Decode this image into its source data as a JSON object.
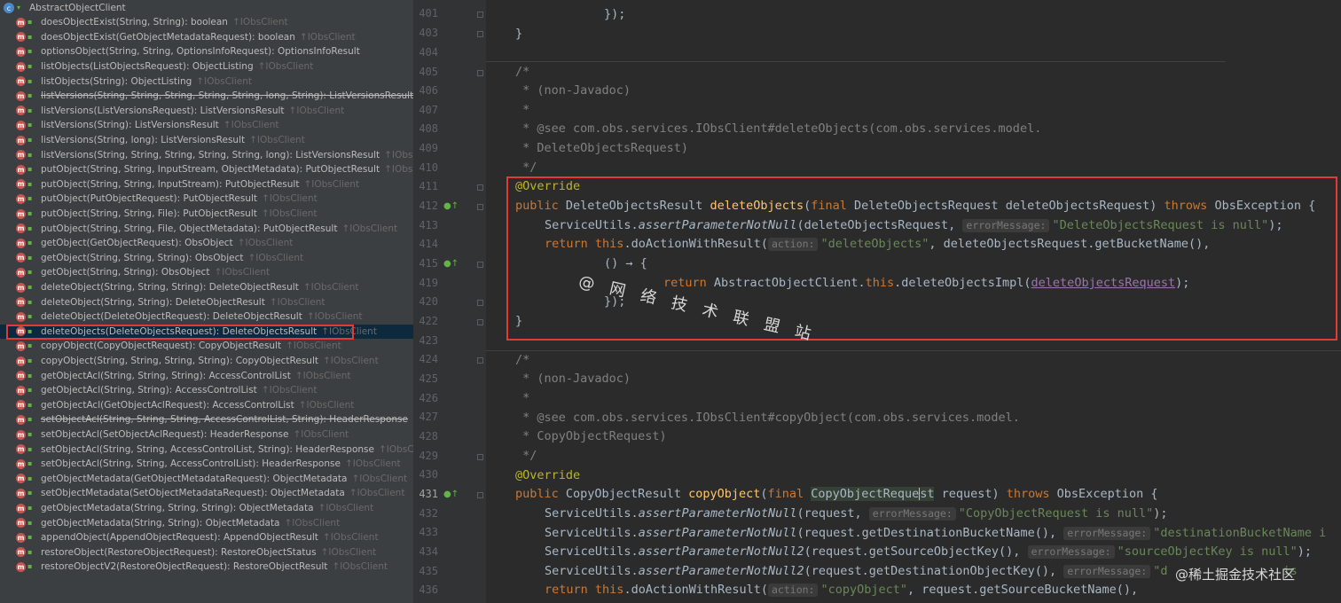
{
  "structure": {
    "root_label": "AbstractObjectClient",
    "methods": [
      {
        "sig": "doesObjectExist(String, String): boolean",
        "iface": "↑IObsClient",
        "deprecated": false
      },
      {
        "sig": "doesObjectExist(GetObjectMetadataRequest): boolean",
        "iface": "↑IObsClient",
        "deprecated": false
      },
      {
        "sig": "optionsObject(String, String, OptionsInfoRequest): OptionsInfoResult",
        "iface": "",
        "deprecated": false
      },
      {
        "sig": "listObjects(ListObjectsRequest): ObjectListing",
        "iface": "↑IObsClient",
        "deprecated": false
      },
      {
        "sig": "listObjects(String): ObjectListing",
        "iface": "↑IObsClient",
        "deprecated": false
      },
      {
        "sig": "listVersions(String, String, String, String, String, long, String): ListVersionsResult",
        "iface": "",
        "deprecated": true
      },
      {
        "sig": "listVersions(ListVersionsRequest): ListVersionsResult",
        "iface": "↑IObsClient",
        "deprecated": false
      },
      {
        "sig": "listVersions(String): ListVersionsResult",
        "iface": "↑IObsClient",
        "deprecated": false
      },
      {
        "sig": "listVersions(String, long): ListVersionsResult",
        "iface": "↑IObsClient",
        "deprecated": false
      },
      {
        "sig": "listVersions(String, String, String, String, String, long): ListVersionsResult",
        "iface": "↑IObsClient",
        "deprecated": false
      },
      {
        "sig": "putObject(String, String, InputStream, ObjectMetadata): PutObjectResult",
        "iface": "↑IObsClient",
        "deprecated": false
      },
      {
        "sig": "putObject(String, String, InputStream): PutObjectResult",
        "iface": "↑IObsClient",
        "deprecated": false
      },
      {
        "sig": "putObject(PutObjectRequest): PutObjectResult",
        "iface": "↑IObsClient",
        "deprecated": false
      },
      {
        "sig": "putObject(String, String, File): PutObjectResult",
        "iface": "↑IObsClient",
        "deprecated": false
      },
      {
        "sig": "putObject(String, String, File, ObjectMetadata): PutObjectResult",
        "iface": "↑IObsClient",
        "deprecated": false
      },
      {
        "sig": "getObject(GetObjectRequest): ObsObject",
        "iface": "↑IObsClient",
        "deprecated": false
      },
      {
        "sig": "getObject(String, String, String): ObsObject",
        "iface": "↑IObsClient",
        "deprecated": false
      },
      {
        "sig": "getObject(String, String): ObsObject",
        "iface": "↑IObsClient",
        "deprecated": false
      },
      {
        "sig": "deleteObject(String, String, String): DeleteObjectResult",
        "iface": "↑IObsClient",
        "deprecated": false
      },
      {
        "sig": "deleteObject(String, String): DeleteObjectResult",
        "iface": "↑IObsClient",
        "deprecated": false
      },
      {
        "sig": "deleteObject(DeleteObjectRequest): DeleteObjectResult",
        "iface": "↑IObsClient",
        "deprecated": false
      },
      {
        "sig": "deleteObjects(DeleteObjectsRequest): DeleteObjectsResult",
        "iface": "↑IObsClient",
        "deprecated": false
      },
      {
        "sig": "copyObject(CopyObjectRequest): CopyObjectResult",
        "iface": "↑IObsClient",
        "deprecated": false
      },
      {
        "sig": "copyObject(String, String, String, String): CopyObjectResult",
        "iface": "↑IObsClient",
        "deprecated": false
      },
      {
        "sig": "getObjectAcl(String, String, String): AccessControlList",
        "iface": "↑IObsClient",
        "deprecated": false
      },
      {
        "sig": "getObjectAcl(String, String): AccessControlList",
        "iface": "↑IObsClient",
        "deprecated": false
      },
      {
        "sig": "getObjectAcl(GetObjectAclRequest): AccessControlList",
        "iface": "↑IObsClient",
        "deprecated": false
      },
      {
        "sig": "setObjectAcl(String, String, String, AccessControlList, String): HeaderResponse",
        "iface": "",
        "deprecated": true
      },
      {
        "sig": "setObjectAcl(SetObjectAclRequest): HeaderResponse",
        "iface": "↑IObsClient",
        "deprecated": false
      },
      {
        "sig": "setObjectAcl(String, String, AccessControlList, String): HeaderResponse",
        "iface": "↑IObsClient",
        "deprecated": false
      },
      {
        "sig": "setObjectAcl(String, String, AccessControlList): HeaderResponse",
        "iface": "↑IObsClient",
        "deprecated": false
      },
      {
        "sig": "getObjectMetadata(GetObjectMetadataRequest): ObjectMetadata",
        "iface": "↑IObsClient",
        "deprecated": false
      },
      {
        "sig": "setObjectMetadata(SetObjectMetadataRequest): ObjectMetadata",
        "iface": "↑IObsClient",
        "deprecated": false
      },
      {
        "sig": "getObjectMetadata(String, String, String): ObjectMetadata",
        "iface": "↑IObsClient",
        "deprecated": false
      },
      {
        "sig": "getObjectMetadata(String, String): ObjectMetadata",
        "iface": "↑IObsClient",
        "deprecated": false
      },
      {
        "sig": "appendObject(AppendObjectRequest): AppendObjectResult",
        "iface": "↑IObsClient",
        "deprecated": false
      },
      {
        "sig": "restoreObject(RestoreObjectRequest): RestoreObjectStatus",
        "iface": "↑IObsClient",
        "deprecated": false
      },
      {
        "sig": "restoreObjectV2(RestoreObjectRequest): RestoreObjectResult",
        "iface": "↑IObsClient",
        "deprecated": false
      }
    ],
    "selected_index": 21
  },
  "gutter": {
    "line_numbers": [
      "401",
      "403",
      "404",
      "405",
      "406",
      "407",
      "408",
      "409",
      "410",
      "411",
      "412",
      "413",
      "414",
      "415",
      "419",
      "420",
      "422",
      "423",
      "424",
      "425",
      "426",
      "427",
      "428",
      "429",
      "430",
      "431",
      "432",
      "433",
      "434",
      "435",
      "436"
    ],
    "current_line": "431"
  },
  "code": {
    "l401_close": "});",
    "l403_brace": "}",
    "l405": "/*",
    "l406": " * (non-Javadoc)",
    "l407": " *",
    "l408": " * @see com.obs.services.IObsClient#deleteObjects(com.obs.services.model.",
    "l409": " * DeleteObjectsRequest)",
    "l410": " */",
    "l411_ann": "@Override",
    "l412_kw1": "public",
    "l412_type": " DeleteObjectsResult ",
    "l412_fn": "deleteObjects",
    "l412_p1": "(",
    "l412_kw2": "final",
    "l412_p2": " DeleteObjectsRequest deleteObjectsRequest) ",
    "l412_kw3": "throws",
    "l412_p3": " ObsException {",
    "l413_a": "ServiceUtils.",
    "l413_fn": "assertParameterNotNull",
    "l413_b": "(deleteObjectsRequest, ",
    "l413_hint": "errorMessage:",
    "l413_str": "\"DeleteObjectsRequest is null\"",
    "l413_c": ");",
    "l414_kw1": "return",
    "l414_kw2": "this",
    "l414_a": ".doActionWithResult(",
    "l414_hint": "action:",
    "l414_str": "\"deleteObjects\"",
    "l414_b": ", deleteObjectsRequest.getBucketName(),",
    "l415": "() → {",
    "l419_kw": "return",
    "l419_a": " AbstractObjectClient.",
    "l419_kw2": "this",
    "l419_b": ".deleteObjectsImpl(",
    "l419_var": "deleteObjectsRequest",
    "l419_c": ");",
    "l420": "});",
    "l422": "}",
    "l424": "/*",
    "l425": " * (non-Javadoc)",
    "l426": " *",
    "l427": " * @see com.obs.services.IObsClient#copyObject(com.obs.services.model.",
    "l428": " * CopyObjectRequest)",
    "l429": " */",
    "l430_ann": "@Override",
    "l431_kw1": "public",
    "l431_type": " CopyObjectResult ",
    "l431_fn": "copyObject",
    "l431_p1": "(",
    "l431_kw2": "final",
    "l431_hl1": "CopyObjectReque",
    "l431_hl2": "st",
    "l431_p2": " request) ",
    "l431_kw3": "throws",
    "l431_p3": " ObsException {",
    "l432_a": "ServiceUtils.",
    "l432_fn": "assertParameterNotNull",
    "l432_b": "(request, ",
    "l432_hint": "errorMessage:",
    "l432_str": "\"CopyObjectRequest is null\"",
    "l432_c": ");",
    "l433_a": "ServiceUtils.",
    "l433_fn": "assertParameterNotNull",
    "l433_b": "(request.getDestinationBucketName(), ",
    "l433_hint": "errorMessage:",
    "l433_str": "\"destinationBucketName i",
    "l434_a": "ServiceUtils.",
    "l434_fn": "assertParameterNotNull2",
    "l434_b": "(request.getSourceObjectKey(), ",
    "l434_hint": "errorMessage:",
    "l434_str": "\"sourceObjectKey is null\"",
    "l434_c": ");",
    "l435_a": "ServiceUtils.",
    "l435_fn": "assertParameterNotNull2",
    "l435_b": "(request.getDestinationObjectKey(), ",
    "l435_hint": "errorMessage:",
    "l435_str": "\"d",
    "l435_tail": "                is",
    "l436_kw1": "return",
    "l436_kw2": "this",
    "l436_a": ".doActionWithResult(",
    "l436_hint": "action:",
    "l436_str": "\"copyObject\"",
    "l436_b": ", request.getSourceBucketName(),"
  },
  "watermark": "@ 网 络 技 术 联 盟 站",
  "corner_watermark": "@稀土掘金技术社区",
  "colors": {
    "highlight_box": "#e53935",
    "keyword": "#cc7832",
    "string": "#6a8759",
    "annotation": "#bbb529",
    "function": "#ffc66d",
    "comment": "#808080"
  }
}
